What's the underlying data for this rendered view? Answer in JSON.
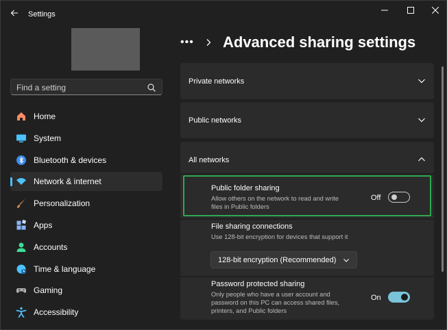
{
  "window": {
    "app_title": "Settings"
  },
  "sidebar": {
    "search_placeholder": "Find a setting",
    "items": [
      {
        "label": "Home",
        "icon": "home-icon",
        "color": "#ff8a65"
      },
      {
        "label": "System",
        "icon": "system-icon",
        "color": "#4cc2ff"
      },
      {
        "label": "Bluetooth & devices",
        "icon": "bluetooth-icon",
        "color": "#3d8ae8"
      },
      {
        "label": "Network & internet",
        "icon": "network-icon",
        "color": "#4cc2ff",
        "active": true
      },
      {
        "label": "Personalization",
        "icon": "brush-icon",
        "color": "#e3a96b"
      },
      {
        "label": "Apps",
        "icon": "apps-icon",
        "color": "#8ab4f8"
      },
      {
        "label": "Accounts",
        "icon": "accounts-icon",
        "color": "#3ddc97"
      },
      {
        "label": "Time & language",
        "icon": "globe-icon",
        "color": "#4cc2ff"
      },
      {
        "label": "Gaming",
        "icon": "gaming-icon",
        "color": "#b0b0b0"
      },
      {
        "label": "Accessibility",
        "icon": "accessibility-icon",
        "color": "#4cc2ff"
      }
    ]
  },
  "main": {
    "page_title": "Advanced sharing settings",
    "sections": {
      "private": "Private networks",
      "public": "Public networks",
      "all": "All networks"
    },
    "settings": {
      "public_folder": {
        "title": "Public folder sharing",
        "desc_line1": "Allow others on the network to read and write",
        "desc_line2": "files in Public folders",
        "state": "Off"
      },
      "file_sharing": {
        "title": "File sharing connections",
        "desc": "Use 128-bit encryption for devices that support it",
        "selected": "128-bit encryption (Recommended)"
      },
      "password": {
        "title": "Password protected sharing",
        "desc_line1": "Only people who have a user account and",
        "desc_line2": "password on this PC can access shared files,",
        "desc_line3": "printers, and Public folders",
        "state": "On"
      }
    }
  },
  "colors": {
    "accent": "#4cc2ff",
    "highlight": "#2fa84f",
    "toggle_on": "#79c4d9"
  }
}
